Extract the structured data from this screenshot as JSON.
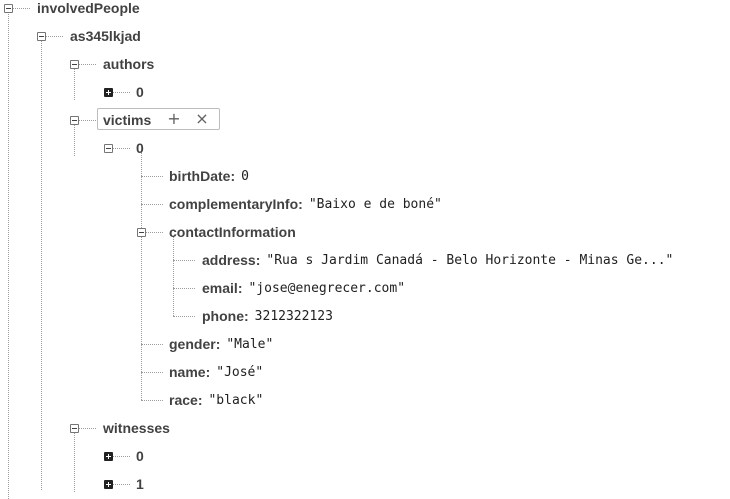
{
  "tree": {
    "root_key": "involvedPeople",
    "id_key": "as345lkjad",
    "authors_key": "authors",
    "authors_item0": "0",
    "victims_key": "victims",
    "victims_item0": "0",
    "birthDate": {
      "key": "birthDate",
      "value": "0"
    },
    "complementaryInfo": {
      "key": "complementaryInfo",
      "value": "\"Baixo e de boné\""
    },
    "contactInformation_key": "contactInformation",
    "address": {
      "key": "address",
      "value": "\"Rua s Jardim Canadá - Belo Horizonte - Minas Ge...\""
    },
    "email": {
      "key": "email",
      "value": "\"jose@enegrecer.com\""
    },
    "phone": {
      "key": "phone",
      "value": "3212322123"
    },
    "gender": {
      "key": "gender",
      "value": "\"Male\""
    },
    "name": {
      "key": "name",
      "value": "\"José\""
    },
    "race": {
      "key": "race",
      "value": "\"black\""
    },
    "witnesses_key": "witnesses",
    "witnesses_item0": "0",
    "witnesses_item1": "1"
  },
  "actions": {
    "add_icon": "+",
    "delete_icon": "×"
  },
  "colors": {
    "text": "#424242",
    "guide": "#9e9e9e",
    "toggle_expanded": "#ffffff",
    "toggle_collapsed": "#212121"
  }
}
